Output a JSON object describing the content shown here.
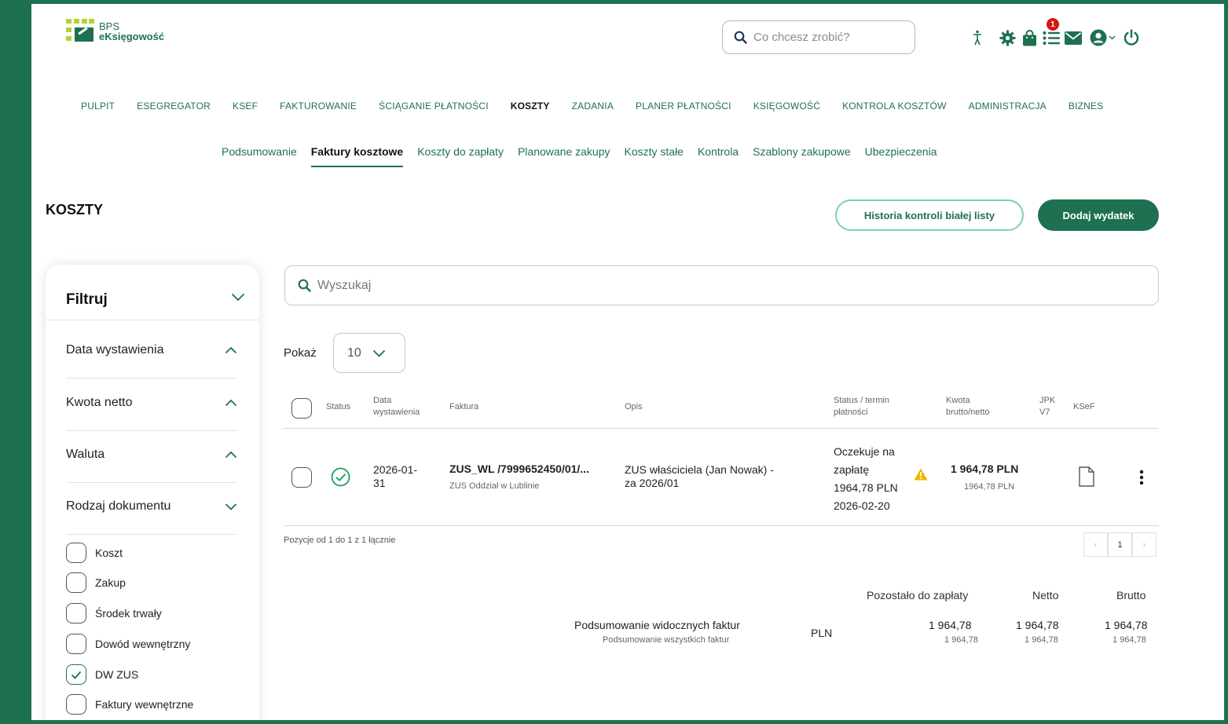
{
  "logo": {
    "line1": "BPS",
    "line2": "eKsięgowość"
  },
  "header": {
    "search_placeholder": "Co chcesz zrobić?",
    "notification_count": "1",
    "icons": [
      "accessibility-icon",
      "gear-icon",
      "bag-icon",
      "list-icon",
      "mail-icon",
      "user-icon",
      "power-icon"
    ]
  },
  "nav": {
    "items": [
      "PULPIT",
      "ESEGREGATOR",
      "KSEF",
      "FAKTUROWANIE",
      "ŚCIĄGANIE PŁATNOŚCI",
      "KOSZTY",
      "ZADANIA",
      "PLANER PŁATNOŚCI",
      "KSIĘGOWOŚĆ",
      "KONTROLA KOSZTÓW",
      "ADMINISTRACJA",
      "BIZNES"
    ],
    "active": "KOSZTY"
  },
  "subnav": {
    "items": [
      "Podsumowanie",
      "Faktury kosztowe",
      "Koszty do zapłaty",
      "Planowane zakupy",
      "Koszty stałe",
      "Kontrola",
      "Szablony zakupowe",
      "Ubezpieczenia"
    ],
    "active": "Faktury kosztowe"
  },
  "page": {
    "title": "KOSZTY",
    "history_button": "Historia kontroli białej listy",
    "add_button": "Dodaj wydatek"
  },
  "filter": {
    "title": "Filtruj",
    "sections": [
      "Data wystawienia",
      "Kwota netto",
      "Waluta",
      "Rodzaj dokumentu"
    ],
    "doc_types": [
      {
        "label": "Koszt",
        "checked": false
      },
      {
        "label": "Zakup",
        "checked": false
      },
      {
        "label": "Środek trwały",
        "checked": false
      },
      {
        "label": "Dowód wewnętrzny",
        "checked": false
      },
      {
        "label": "DW ZUS",
        "checked": true
      },
      {
        "label": "Faktury wewnętrzne",
        "checked": false
      }
    ]
  },
  "main": {
    "search_placeholder": "Wyszukaj",
    "show_label": "Pokaż",
    "page_size": "10"
  },
  "table": {
    "headers": {
      "status": "Status",
      "date_1": "Data",
      "date_2": "wystawienia",
      "invoice": "Faktura",
      "desc": "Opis",
      "due_1": "Status / termin",
      "due_2": "płatności",
      "amount_1": "Kwota",
      "amount_2": "brutto/netto",
      "jpk_1": "JPK",
      "jpk_2": "V7",
      "ksef": "KSeF"
    },
    "rows": [
      {
        "date_1": "2026-01-",
        "date_2": "31",
        "invoice": "ZUS_WL /7999652450/01/...",
        "issuer": "ZUS Oddział w Lublinie",
        "desc_1": "ZUS właściciela (Jan Nowak) -",
        "desc_2": "za 2026/01",
        "status_1": "Oczekuje na",
        "status_2": "zapłatę",
        "status_3": "1964,78 PLN",
        "status_4": "2026-02-20",
        "gross": "1 964,78 PLN",
        "net": "1964,78 PLN"
      }
    ]
  },
  "pagination": {
    "info": "Pozycje od 1 do 1 z 1 łącznie",
    "current": "1",
    "prev": "‹",
    "next": "›"
  },
  "summary": {
    "headers": [
      "Pozostało do zapłaty",
      "Netto",
      "Brutto"
    ],
    "visible_label": "Podsumowanie widocznych faktur",
    "all_label": "Podsumowanie wszystkich faktur",
    "currency": "PLN",
    "visible": [
      "1 964,78",
      "1 964,78",
      "1 964,78"
    ],
    "all": [
      "1 964,78",
      "1 964,78",
      "1 964,78"
    ]
  },
  "colors": {
    "brand": "#1e7150",
    "accent_light": "#b4d334",
    "warning": "#f5b400",
    "badge": "#d61515"
  }
}
